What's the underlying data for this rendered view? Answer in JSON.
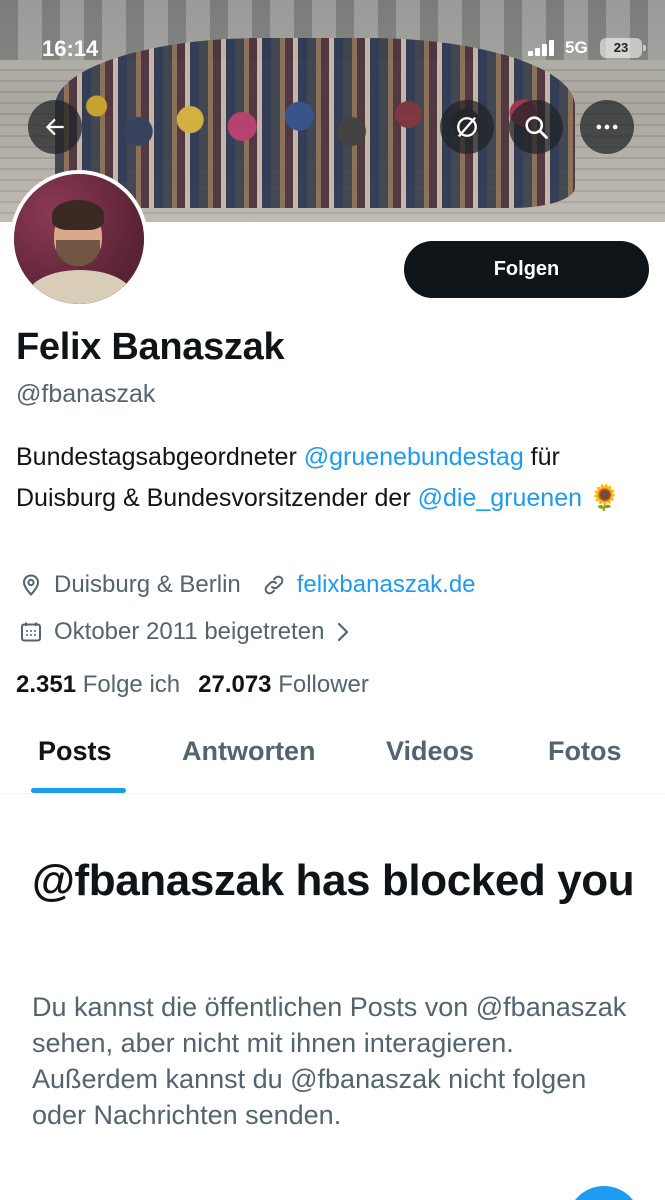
{
  "status_bar": {
    "time": "16:14",
    "network": "5G",
    "battery": "23"
  },
  "header": {
    "back_icon": "arrow-left-icon",
    "mute_icon": "notifications-off-icon",
    "search_icon": "search-icon",
    "more_icon": "more-horizontal-icon",
    "overlay_color": "#1e2226"
  },
  "profile": {
    "name": "Felix Banaszak",
    "handle": "@fbanaszak",
    "follow_label": "Folgen",
    "bio_part1": "Bundestagsabgeordneter ",
    "bio_mention1": "@gruenebundestag",
    "bio_part2": " für Duisburg & Bundesvorsitzender der ",
    "bio_mention2": "@die_gruenen",
    "bio_emoji": "🌻",
    "location": "Duisburg & Berlin",
    "website": "felixbanaszak.de",
    "joined": "Oktober 2011 beigetreten",
    "following_count": "2.351",
    "following_label": "Folge ich",
    "followers_count": "27.073",
    "followers_label": "Follower"
  },
  "tabs": [
    {
      "label": "Posts",
      "active": true
    },
    {
      "label": "Antworten",
      "active": false
    },
    {
      "label": "Videos",
      "active": false
    },
    {
      "label": "Fotos",
      "active": false
    }
  ],
  "blocked": {
    "title": "@fbanaszak has blocked you",
    "body": "Du kannst die öffentlichen Posts von @fbanaszak sehen, aber nicht mit ihnen interagieren. Außerdem kannst du @fbanaszak nicht folgen oder Nachrichten senden."
  },
  "colors": {
    "accent": "#1d9bf0",
    "text_primary": "#0f1419",
    "text_secondary": "#536471",
    "button_bg": "#0f1419"
  }
}
